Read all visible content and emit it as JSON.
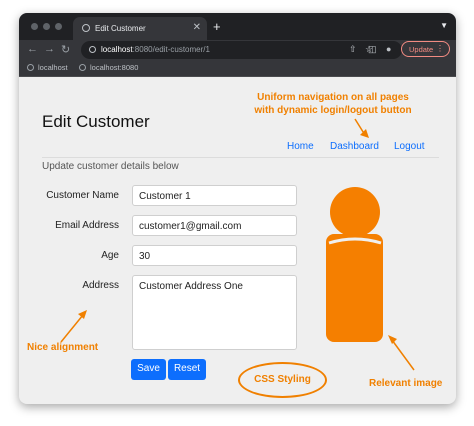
{
  "browser": {
    "tab_title": "Edit Customer",
    "tab_close": "✕",
    "new_tab": "+",
    "url_host": "localhost",
    "url_path": ":8080/edit-customer/1",
    "update_label": "Update",
    "bookmarks": [
      "localhost",
      "localhost:8080"
    ]
  },
  "page": {
    "title": "Edit Customer",
    "nav": [
      "Home",
      "Dashboard",
      "Logout"
    ],
    "subtitle": "Update customer details below",
    "form": {
      "name_label": "Customer Name",
      "name_value": "Customer 1",
      "email_label": "Email Address",
      "email_value": "customer1@gmail.com",
      "age_label": "Age",
      "age_value": "30",
      "address_label": "Address",
      "address_value": "Customer Address One"
    },
    "buttons": {
      "save": "Save",
      "reset": "Reset"
    }
  },
  "annotations": {
    "nav_note_1": "Uniform navigation on all pages",
    "nav_note_2": "with dynamic login/logout button",
    "alignment": "Nice alignment",
    "styling": "CSS Styling",
    "image": "Relevant image"
  },
  "colors": {
    "accent": "#0d6efd",
    "annotation": "#f08000",
    "person_icon": "#f57f00"
  },
  "icons": [
    "back-arrow-icon",
    "forward-arrow-icon",
    "reload-icon",
    "info-icon",
    "share-icon",
    "star-icon",
    "sidebar-icon",
    "profile-icon",
    "person-icon"
  ]
}
